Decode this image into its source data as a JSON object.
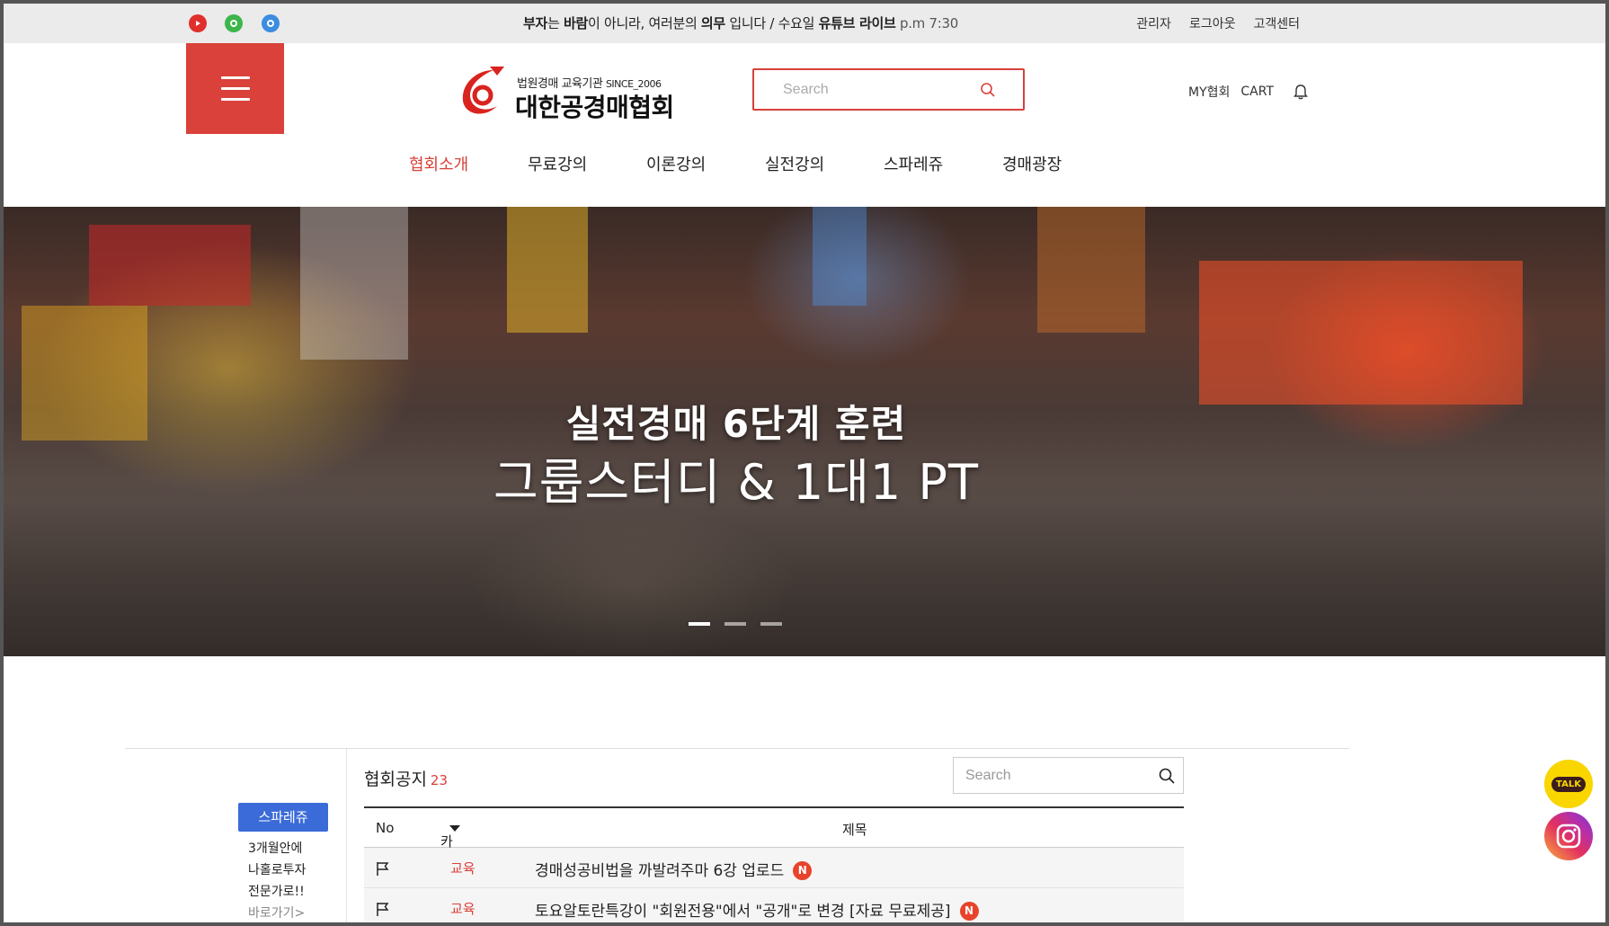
{
  "topbar": {
    "sns": [
      {
        "name": "youtube-icon",
        "color": "#e0302c"
      },
      {
        "name": "kakao-icon",
        "color": "#3cb64a"
      },
      {
        "name": "blog-icon",
        "color": "#3c8de0"
      }
    ],
    "notice": {
      "p1": "부자",
      "p2": "는 ",
      "p3": "바람",
      "p4": "이 아니라, 여러분의 ",
      "p5": "의무",
      "p6": " 입니다  / 수요일 ",
      "p7": "유튜브 라이브",
      "p8": " p.m 7:30"
    },
    "links": [
      "관리자",
      "로그아웃",
      "고객센터"
    ]
  },
  "header": {
    "logo_sub": "법원경매 교육기관",
    "logo_since": "SINCE_2006",
    "logo_main": "대한공경매협회",
    "search_placeholder": "Search",
    "my": "MY협회",
    "cart": "CART"
  },
  "nav": {
    "items": [
      "협회소개",
      "무료강의",
      "이론강의",
      "실전강의",
      "스파레쥬",
      "경매광장"
    ],
    "active_index": 0
  },
  "hero": {
    "line1": "실전경매 6단계 훈련",
    "line2": "그룹스터디 & 1대1 PT",
    "slides": 3,
    "active_slide": 0
  },
  "sidebar": {
    "button": "스파레쥬",
    "lines": [
      "3개월안에",
      "나홀로투자",
      "전문가로!!"
    ],
    "link": "바로가기>"
  },
  "board": {
    "title": "협회공지",
    "count": "23",
    "search_placeholder": "Search",
    "columns": {
      "no": "No",
      "category": "카테고리",
      "title": "제목"
    },
    "rows": [
      {
        "category": "교육",
        "title": "경매성공비법을 까발려주마 6강 업로드",
        "badge": "N"
      },
      {
        "category": "교육",
        "title": "토요알토란특강이 \"회원전용\"에서 \"공개\"로 변경 [자료 무료제공]",
        "badge": "N"
      }
    ]
  },
  "floating": {
    "talk": "TALK"
  },
  "colors": {
    "accent": "#d9413a",
    "blue": "#3b6bd8",
    "topbar_bg": "#ebebeb"
  }
}
